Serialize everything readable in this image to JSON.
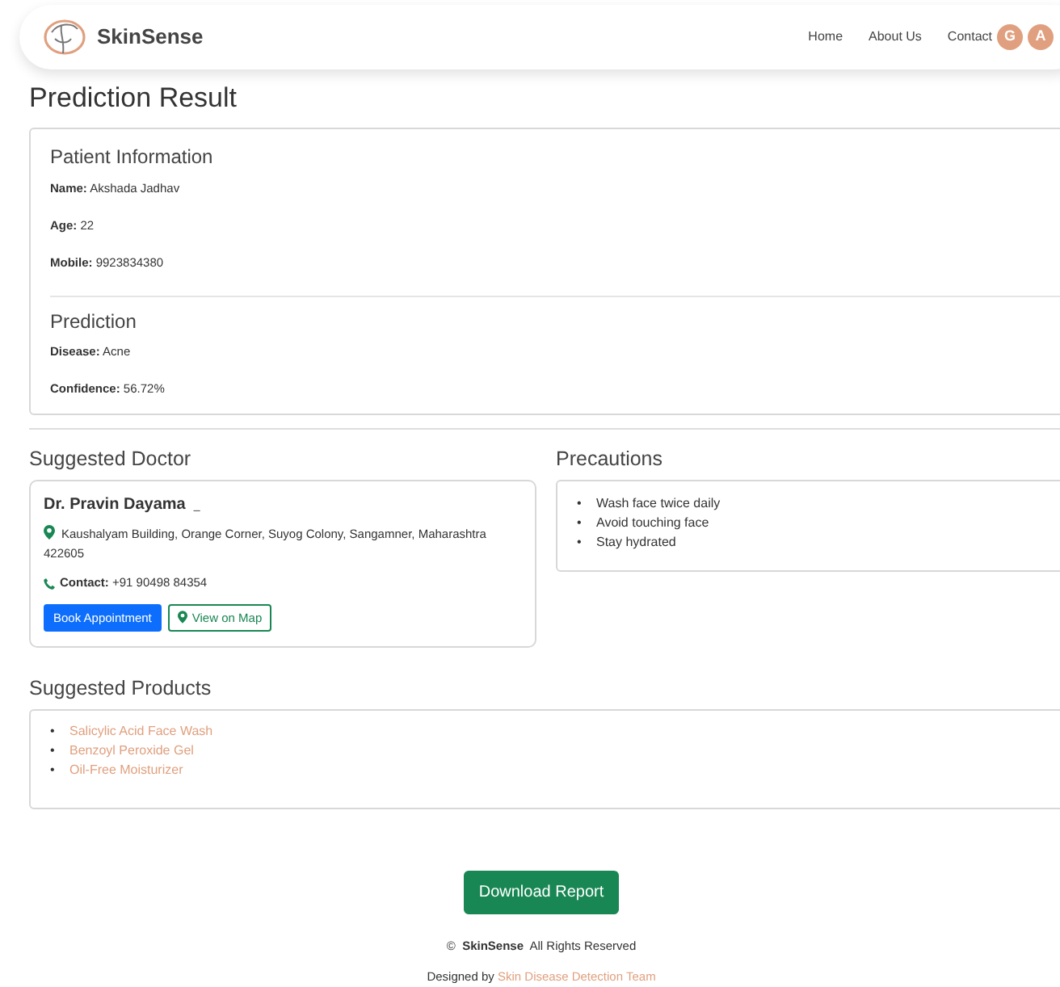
{
  "navbar": {
    "brand": "SkinSense",
    "links": [
      "Home",
      "About Us",
      "Contact"
    ],
    "avatars": [
      "G",
      "A"
    ]
  },
  "page_title": "Prediction Result",
  "patient": {
    "heading": "Patient Information",
    "fields": [
      "**Name:** Akshada Jadhav",
      "**Age:** 22",
      "**Mobile:** 9923834380"
    ]
  },
  "prediction": {
    "heading": "Prediction",
    "fields": [
      "**Disease:** Acne",
      "**Confidence:** 56.72%"
    ]
  },
  "doctor": {
    "heading": "Suggested Doctor",
    "name": "Dr. Pravin Dayama",
    "name_mark": "_",
    "address": "Kaushalyam Building, Orange Corner, Suyog Colony, Sangamner, Maharashtra 422605",
    "contact": "**Contact:** +91 90498 84354",
    "buttons": [
      "Book Appointment",
      "View on Map"
    ]
  },
  "precautions": {
    "heading": "Precautions",
    "marker": "•",
    "items": [
      "Wash face twice daily",
      "Avoid touching face",
      "Stay hydrated"
    ]
  },
  "products": {
    "heading": "Suggested Products",
    "marker": "•",
    "items": [
      "Salicylic Acid Face Wash",
      "Benzoyl Peroxide Gel",
      "Oil-Free Moisturizer"
    ]
  },
  "download_button": "Download Report",
  "footer": {
    "copyright": "©  **SkinSense**  All Rights Reserved",
    "designed_by": "Designed by",
    "team_link": "Skin Disease Detection Team"
  }
}
